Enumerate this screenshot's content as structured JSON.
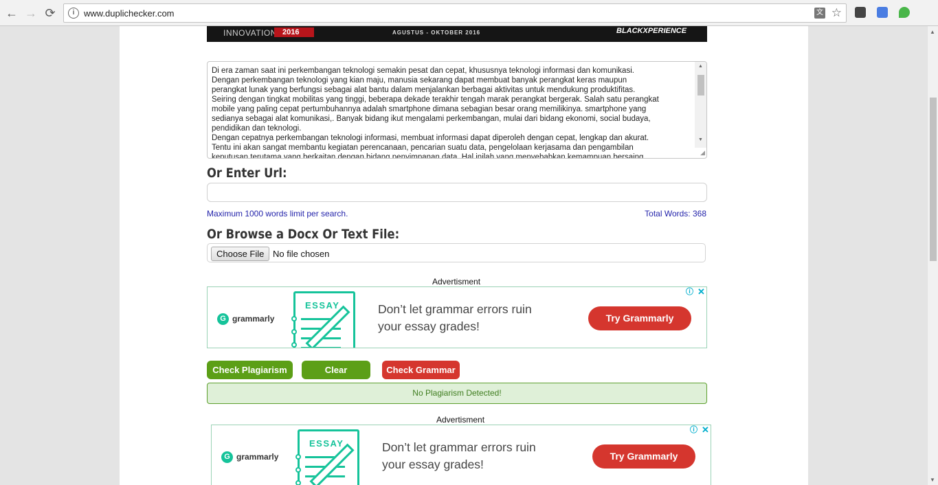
{
  "browser": {
    "url": "www.duplichecker.com",
    "info_icon_glyph": "i",
    "translate_glyph": "文",
    "nav_glyphs": {
      "back": "←",
      "forward": "→",
      "reload": "⟳"
    },
    "star_glyph": "☆"
  },
  "banner": {
    "left_text": "INNOVATION",
    "year": "2016",
    "middle_text": "AGUSTUS - OKTOBER 2016",
    "right_text": "BLACKXPERIENCE"
  },
  "editor": {
    "text": "Di era zaman saat ini perkembangan teknologi semakin pesat dan cepat, khususnya teknologi informasi dan komunikasi.\nDengan perkembangan teknologi yang kian maju, manusia sekarang dapat membuat banyak perangkat keras maupun\nperangkat lunak yang berfungsi sebagai alat bantu dalam menjalankan berbagai aktivitas untuk mendukung produktifitas.\nSeiring dengan tingkat mobilitas yang tinggi, beberapa dekade terakhir tengah marak perangkat bergerak. Salah satu perangkat\nmobile yang paling cepat pertumbuhannya adalah smartphone dimana sebagian besar orang memilikinya. smartphone yang\nsedianya sebagai alat komunikasi,. Banyak bidang ikut mengalami perkembangan, mulai dari bidang ekonomi, social budaya,\npendidikan dan teknologi.\nDengan cepatnya perkembangan teknologi informasi, membuat informasi dapat diperoleh dengan cepat, lengkap dan akurat.\nTentu ini akan sangat membantu kegiatan perencanaan, pencarian suatu data, pengelolaan kerjasama dan pengambilan\nkeputusan terutama yang berkaitan dengan bidang penyimpanan data. Hal inilah yang menyebabkan kemampuan bersaing",
    "scroll_up_glyph": "▲",
    "scroll_down_glyph": "▼",
    "resize_glyph": "◢"
  },
  "url_section": {
    "heading": "Or Enter Url:",
    "input_value": "",
    "limit_text": "Maximum 1000 words limit per search.",
    "total_words": "Total Words: 368"
  },
  "file_section": {
    "heading": "Or Browse a Docx Or Text File:",
    "choose_label": "Choose File",
    "status": "No file chosen"
  },
  "ads": [
    {
      "label": "Advertisment",
      "brand": "grammarly",
      "brand_glyph": "G",
      "doc_title": "ESSAY",
      "line1": "Don’t let grammar errors ruin",
      "line2": "your essay grades!",
      "cta": "Try Grammarly",
      "info_glyph": "ⓘ",
      "close_glyph": "✕"
    },
    {
      "label": "Advertisment",
      "brand": "grammarly",
      "brand_glyph": "G",
      "doc_title": "ESSAY",
      "line1": "Don’t let grammar errors ruin",
      "line2": "your essay grades!",
      "cta": "Try Grammarly",
      "info_glyph": "ⓘ",
      "close_glyph": "✕"
    }
  ],
  "actions": {
    "check_plagiarism": "Check Plagiarism",
    "clear": "Clear",
    "check_grammar": "Check Grammar"
  },
  "result_text": "No Plagiarism Detected!",
  "colors": {
    "green_button": "#5c9f17",
    "red_button": "#d5362e",
    "grammarly_green": "#15c39a",
    "link_blue": "#2222aa"
  }
}
